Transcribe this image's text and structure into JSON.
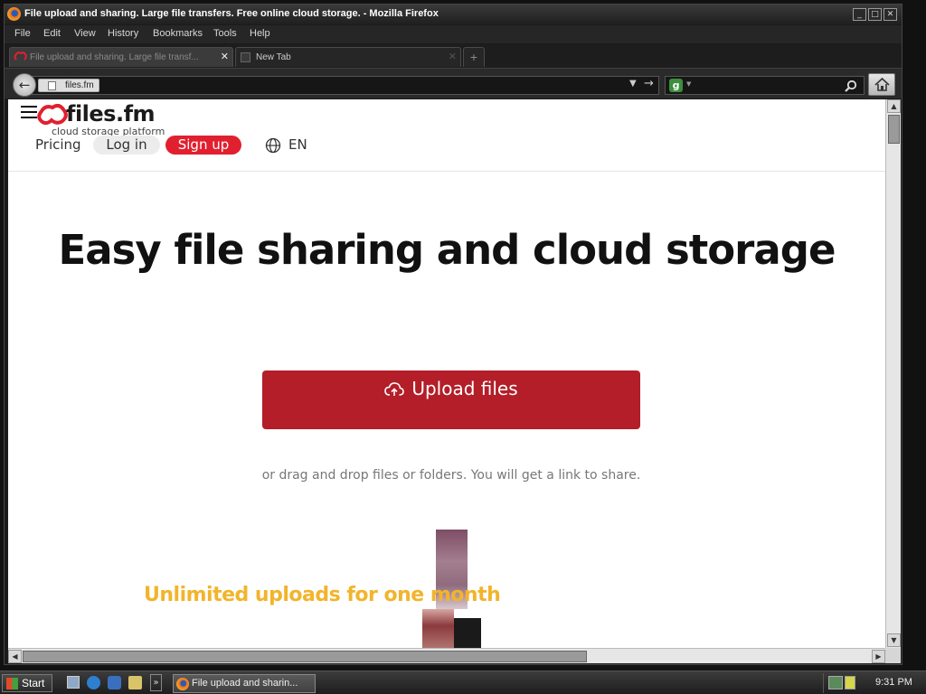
{
  "window": {
    "title": "File upload and sharing. Large file transfers. Free online cloud storage. - Mozilla Firefox"
  },
  "menu": [
    "File",
    "Edit",
    "View",
    "History",
    "Bookmarks",
    "Tools",
    "Help"
  ],
  "tabs": [
    {
      "label": "File upload and sharing. Large file transf...",
      "active": true
    },
    {
      "label": "New Tab",
      "active": false
    }
  ],
  "nav": {
    "identity": "files.fm",
    "url": ""
  },
  "site": {
    "logo_text": "files.fm",
    "logo_tagline": "cloud storage platform",
    "nav": {
      "pricing": "Pricing",
      "login": "Log in",
      "signup": "Sign up",
      "language": "EN"
    },
    "hero_title": "Easy file sharing and cloud storage",
    "upload_button": "Upload files",
    "drag_hint": "or drag and drop files or folders. You will get a link to share.",
    "promo": "Unlimited uploads for one month"
  },
  "colors": {
    "brand_red": "#e1202f",
    "upload_button": "#b31e28",
    "promo_yellow": "#f2b42b"
  },
  "taskbar": {
    "start": "Start",
    "active_window": "File upload and sharin...",
    "clock": "9:31 PM"
  }
}
